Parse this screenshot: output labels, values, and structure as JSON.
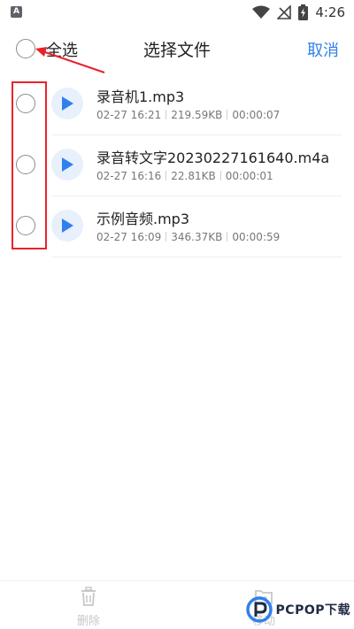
{
  "status_bar": {
    "time": "4:26",
    "app_icon_letter": "A"
  },
  "header": {
    "select_all_label": "全选",
    "title": "选择文件",
    "cancel_label": "取消"
  },
  "files": [
    {
      "name": "录音机1.mp3",
      "date": "02-27 16:21",
      "size": "219.59KB",
      "duration": "00:00:07"
    },
    {
      "name": "录音转文字20230227161640.m4a",
      "date": "02-27 16:16",
      "size": "22.81KB",
      "duration": "00:00:01"
    },
    {
      "name": "示例音频.mp3",
      "date": "02-27 16:09",
      "size": "346.37KB",
      "duration": "00:00:59"
    }
  ],
  "bottom_bar": {
    "delete_label": "删除",
    "move_label": "移动"
  },
  "watermark": {
    "text": "PCPOP下载"
  },
  "colors": {
    "accent": "#2f80ed",
    "annotation": "#e8232c",
    "play_bg": "#e8f0fc"
  },
  "icons": {
    "status": [
      "wifi-icon",
      "no-signal-icon",
      "battery-charging-icon"
    ],
    "play": "play-icon",
    "delete": "trash-icon",
    "move": "folder-move-icon"
  }
}
